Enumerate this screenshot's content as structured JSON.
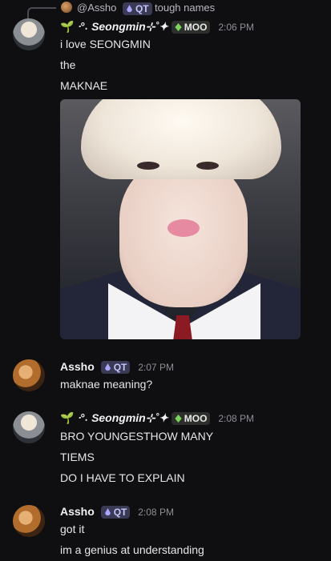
{
  "reply": {
    "name": "@Assho",
    "badge": "QT",
    "text": "tough names"
  },
  "messages": [
    {
      "author": "Seongmin",
      "author_prefix": "ᐧ°˖ ",
      "author_suffix": "⊹˚✦",
      "badge": "MOO",
      "time": "2:06 PM",
      "lines": [
        "i love SEONGMIN",
        "the",
        "MAKNAE"
      ]
    },
    {
      "author": "Assho",
      "badge": "QT",
      "time": "2:07 PM",
      "lines": [
        "maknae meaning?"
      ]
    },
    {
      "author": "Seongmin",
      "author_prefix": "ᐧ°˖ ",
      "author_suffix": "⊹˚✦",
      "badge": "MOO",
      "time": "2:08 PM",
      "lines": [
        "BRO YOUNGESTHOW MANY",
        "TIEMS",
        "DO I HAVE TO EXPLAIN"
      ]
    },
    {
      "author": "Assho",
      "badge": "QT",
      "time": "2:08 PM",
      "lines": [
        "got it",
        "im a genius at understanding"
      ]
    }
  ],
  "colors": {
    "background": "#0f0f11",
    "qt_badge": "#3a3a55",
    "moo_badge": "#2c2f2c",
    "sprout": "#8bd35a"
  },
  "icons": {
    "sprout": "seedling-icon",
    "gem": "green-gem-icon",
    "droplet": "purple-drop-icon"
  }
}
